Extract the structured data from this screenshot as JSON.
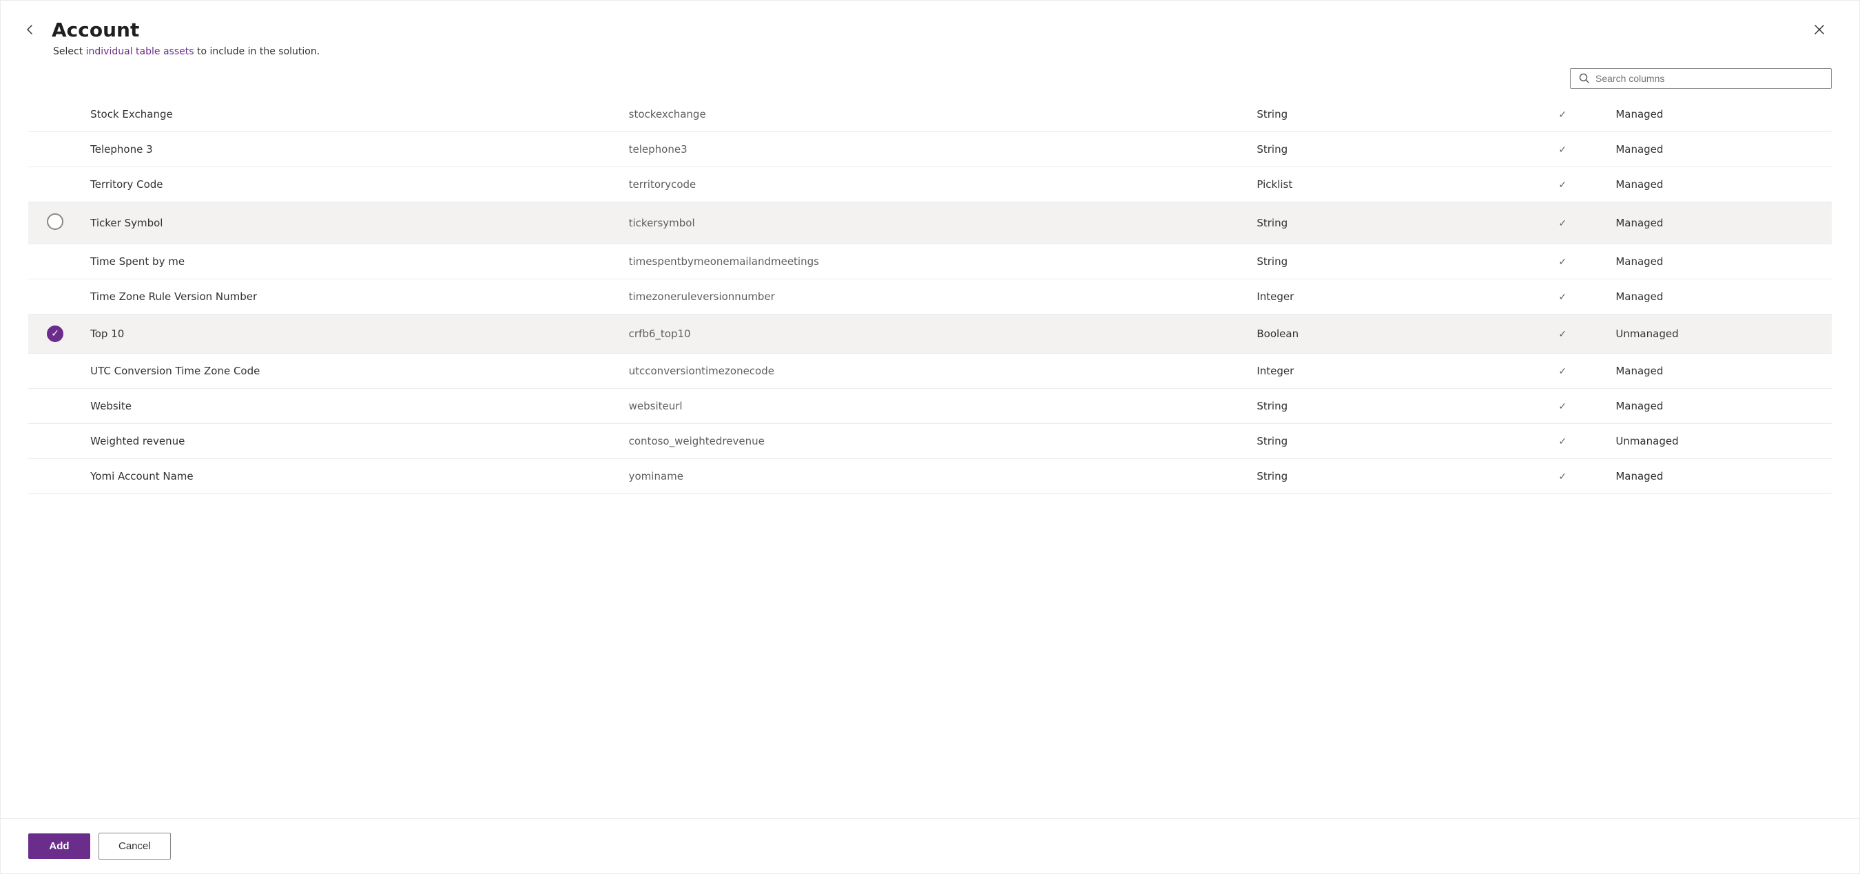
{
  "header": {
    "title": "Account",
    "subtitle_static": "Select ",
    "subtitle_highlight": "individual table assets",
    "subtitle_rest": " to include in the solution."
  },
  "search": {
    "placeholder": "Search columns",
    "value": ""
  },
  "rows": [
    {
      "id": 1,
      "checked": false,
      "name": "Stock Exchange",
      "logical": "stockexchange",
      "type": "String",
      "managed": "Managed",
      "highlighted": false
    },
    {
      "id": 2,
      "checked": false,
      "name": "Telephone 3",
      "logical": "telephone3",
      "type": "String",
      "managed": "Managed",
      "highlighted": false
    },
    {
      "id": 3,
      "checked": false,
      "name": "Territory Code",
      "logical": "territorycode",
      "type": "Picklist",
      "managed": "Managed",
      "highlighted": false
    },
    {
      "id": 4,
      "checked": false,
      "name": "Ticker Symbol",
      "logical": "tickersymbol",
      "type": "String",
      "managed": "Managed",
      "highlighted": true,
      "circled": true
    },
    {
      "id": 5,
      "checked": false,
      "name": "Time Spent by me",
      "logical": "timespentbymeonemailandmeetings",
      "type": "String",
      "managed": "Managed",
      "highlighted": false
    },
    {
      "id": 6,
      "checked": false,
      "name": "Time Zone Rule Version Number",
      "logical": "timezoneruleversionnumber",
      "type": "Integer",
      "managed": "Managed",
      "highlighted": false
    },
    {
      "id": 7,
      "checked": true,
      "name": "Top 10",
      "logical": "crfb6_top10",
      "type": "Boolean",
      "managed": "Unmanaged",
      "highlighted": true
    },
    {
      "id": 8,
      "checked": false,
      "name": "UTC Conversion Time Zone Code",
      "logical": "utcconversiontimezonecode",
      "type": "Integer",
      "managed": "Managed",
      "highlighted": false
    },
    {
      "id": 9,
      "checked": false,
      "name": "Website",
      "logical": "websiteurl",
      "type": "String",
      "managed": "Managed",
      "highlighted": false
    },
    {
      "id": 10,
      "checked": false,
      "name": "Weighted revenue",
      "logical": "contoso_weightedrevenue",
      "type": "String",
      "managed": "Unmanaged",
      "highlighted": false
    },
    {
      "id": 11,
      "checked": false,
      "name": "Yomi Account Name",
      "logical": "yominame",
      "type": "String",
      "managed": "Managed",
      "highlighted": false
    }
  ],
  "footer": {
    "add_label": "Add",
    "cancel_label": "Cancel"
  }
}
